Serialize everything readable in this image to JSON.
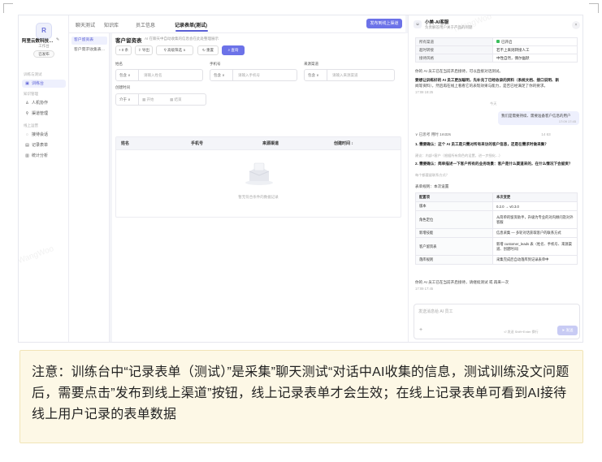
{
  "sidebar": {
    "logo_letter": "R",
    "agent_name": "阿里云数科技…",
    "agent_status": "工作台",
    "publish_pill": "已发布",
    "section_train": "训练与测试",
    "train_item": "训练台",
    "section_knowledge": "知识管理",
    "kb_items": [
      "人机协作",
      "渠道管理"
    ],
    "section_online": "线上运营",
    "online_items": [
      "接待会话",
      "记录表单",
      "统计分析"
    ],
    "icons": [
      "train-icon",
      "people-icon",
      "link-icon",
      "chat-icon",
      "form-icon",
      "chart-icon"
    ]
  },
  "tabs": [
    "聊天测试",
    "知识库",
    "员工信息",
    "记录表单(测试)"
  ],
  "publish_button": "发布到线上渠道",
  "form_list": [
    "客户留资表",
    "客户需求收集表…"
  ],
  "main": {
    "title": "客户留资表",
    "desc": "AI 在聊天中自动收集的信息会在此处整理展示",
    "buttons": {
      "add": "+ 0 条",
      "export": "导出",
      "filter": "高级筛选",
      "reset": "重置",
      "search": "查询"
    },
    "fields": [
      {
        "label": "姓名",
        "select": "包含",
        "placeholder": "请输入姓名"
      },
      {
        "label": "手机号",
        "select": "包含",
        "placeholder": "请输入手机号"
      },
      {
        "label": "来源渠道",
        "select": "包含",
        "placeholder": "请输入来源渠道"
      }
    ],
    "time_label": "创建时间",
    "time_select": "介于",
    "time_start": "开始",
    "time_end": "结束",
    "columns": [
      "姓名",
      "手机号",
      "来源渠道",
      "创建时间 ↕"
    ],
    "empty_text": "暂无符合条件的数据记录"
  },
  "chat": {
    "title": "小美-AI客服",
    "subtitle": "负责解答用户关于产品的问题",
    "close": "×",
    "info_rows": [
      [
        "所有渠道",
        "已开启"
      ],
      [
        "超时转接",
        "若不上来则转接人工"
      ],
      [
        "接待风格",
        "中性自然，偶尔幽默"
      ]
    ],
    "sys_1": "你的 AI 员工已在当前开启接待，可以直接对话测试。",
    "sys_2": "要想让训练好的 AI 员工更加聪明，先补充了已经收录的资料（系统文档、接口说明、新",
    "sys_3": "闻等资料），然后再在线上看看它的表现效果与能力，是否已经满足了你的要求。",
    "sys_time": "17:08 19:25",
    "divider": "今天",
    "user_msg": "我们是需要持续、需要准备客户信息的用户",
    "user_time": "17:09 17:45",
    "thinking": "∨ 已思考 用时 1m32s",
    "thinking_tag": "14  63",
    "q1": "1. 需要确认：这个 AI 员工是只需对所有来访的客户信息，还是在需求时做采集？",
    "q1_opt": "建议：内部+客户（根据所有角色的设置，进一步细化…）",
    "q2": "2. 需要确认：简单描述一下客户所有的业务场景：客户是什么渠道来的，在什么情况下会留资？",
    "q2_opt": "每个都要留联系方式？",
    "update_title": "表单规则：本次设置",
    "update_header": [
      "配置项",
      "本次变更"
    ],
    "update_rows": [
      [
        "版本",
        "0.2.0 → v0.3.0"
      ],
      [
        "角色定位",
        "从简单的留资助手，升级为专业的对内顾问及对外客服"
      ],
      [
        "新增技能",
        "信息采集 — 多轮对话获取客户的联系方式"
      ],
      [
        "客户留资表",
        "新增 customer_leads 表（姓名、手机号、来源渠道、创建时间）"
      ],
      [
        "落库规则",
        "采集完成后自动落库到记录表单中"
      ]
    ],
    "final": "你的 AI 员工已在当前开启接待，请继续测试 或 再来一次",
    "final_time": "17:09 17:45",
    "input_placeholder": "发送消息给 AI 员工",
    "input_plus": "+",
    "input_hint": "⏎ 发送  Shift+Enter 换行",
    "send": "发送"
  },
  "watermark": "iWangWoo",
  "note": "注意：训练台中“记录表单（测试）”是采集”聊天测试“对话中AI收集的信息，测试训练没文问题后，需要点击”发布到线上渠道”按钮，线上记录表单才会生效；在线上记录表单可看到AI接待线上用户记录的表单数据"
}
